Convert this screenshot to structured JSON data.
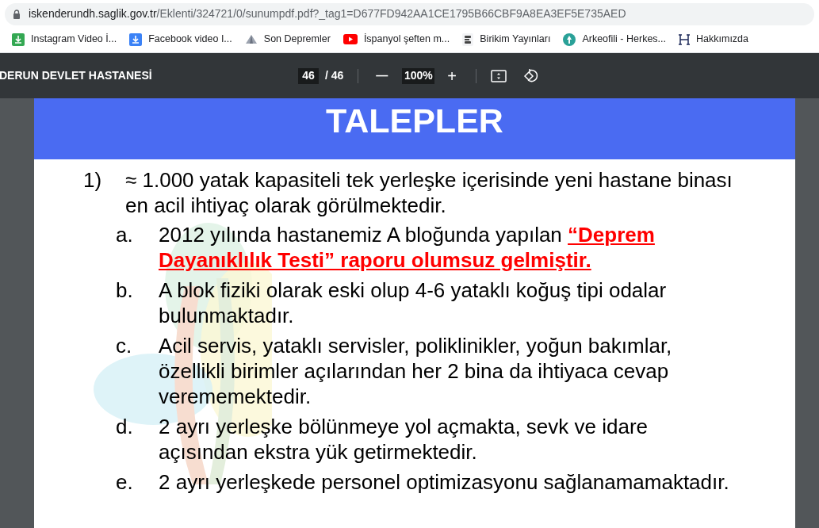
{
  "address_bar": {
    "host": "iskenderundh.saglik.gov.tr",
    "path": "/Eklenti/324721/0/sunumpdf.pdf?_tag1=D677FD942AA1CE1795B66CBF9A8EA3EF5E735AED"
  },
  "bookmarks": [
    {
      "label": "Instagram Video İ...",
      "kind": "download-green"
    },
    {
      "label": "Facebook video I...",
      "kind": "download-blue"
    },
    {
      "label": "Son Depremler",
      "kind": "pyramid"
    },
    {
      "label": "İspanyol şeften m...",
      "kind": "youtube"
    },
    {
      "label": "Birikim Yayınları",
      "kind": "book"
    },
    {
      "label": "Arkeofili - Herkes...",
      "kind": "arkeofili"
    },
    {
      "label": "Hakkımızda",
      "kind": "letter"
    }
  ],
  "pdf_toolbar": {
    "title": "DERUN DEVLET HASTANESİ",
    "page": "46",
    "page_total": "/ 46",
    "zoom_out": "—",
    "zoom": "100%",
    "zoom_in": "+"
  },
  "slide": {
    "title": "TALEPLER",
    "number": "1)",
    "lead": "≈ 1.000 yatak kapasiteli tek yerleşke içerisinde yeni hastane binası en acil ihtiyaç olarak görülmektedir.",
    "items": [
      {
        "letter": "a.",
        "text": "2012 yılında hastanemiz A bloğunda yapılan **“Deprem Dayanıklılık Testi” raporu olumsuz gelmiştir.**"
      },
      {
        "letter": "b.",
        "text": "A blok fiziki olarak eski olup 4-6 yataklı koğuş tipi odalar bulunmaktadır."
      },
      {
        "letter": "c.",
        "text": "Acil servis, yataklı servisler, poliklinikler, yoğun bakımlar, özellikli birimler açılarından her 2 bina da ihtiyaca cevap verememektedir."
      },
      {
        "letter": "d.",
        "text": "2 ayrı yerleşke bölünmeye yol açmakta, sevk ve idare açısından ekstra yük getirmektedir."
      },
      {
        "letter": "e.",
        "text": "2 ayrı yerleşkede personel optimizasyonu sağlanamamaktadır."
      }
    ]
  }
}
